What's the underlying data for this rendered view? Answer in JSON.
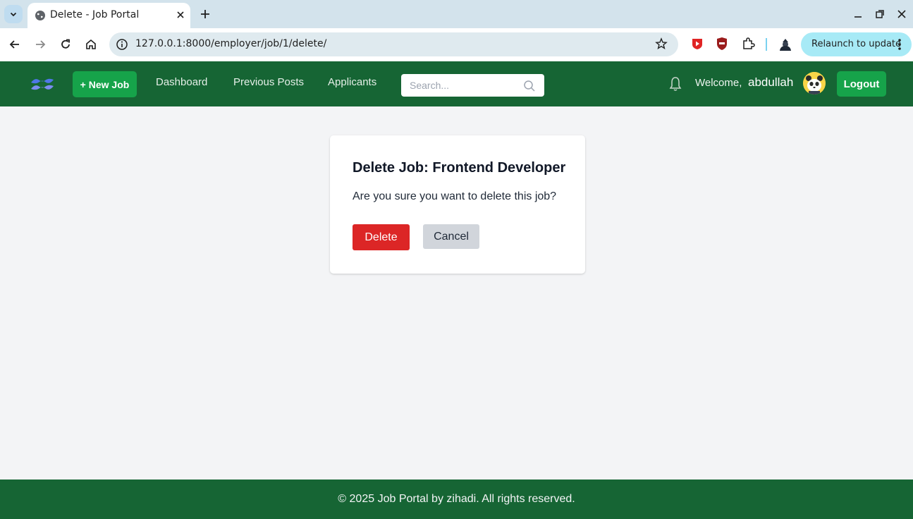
{
  "browser": {
    "tab_title": "Delete - Job Portal",
    "url": "127.0.0.1:8000/employer/job/1/delete/",
    "relaunch_label": "Relaunch to update"
  },
  "navbar": {
    "new_job_label": "+ New Job",
    "links": [
      "Dashboard",
      "Previous Posts",
      "Applicants"
    ],
    "search_placeholder": "Search...",
    "welcome_label": "Welcome,",
    "username": "abdullah",
    "logout_label": "Logout"
  },
  "card": {
    "title": "Delete Job: Frontend Developer",
    "message": "Are you sure you want to delete this job?",
    "delete_label": "Delete",
    "cancel_label": "Cancel"
  },
  "footer": {
    "text": "© 2025 Job Portal by zihadi. All rights reserved."
  },
  "colors": {
    "navbar_bg": "#166534",
    "accent_green": "#16a34a",
    "danger_red": "#dc2626",
    "cancel_gray": "#d1d5db",
    "page_bg": "#f3f4f6"
  }
}
